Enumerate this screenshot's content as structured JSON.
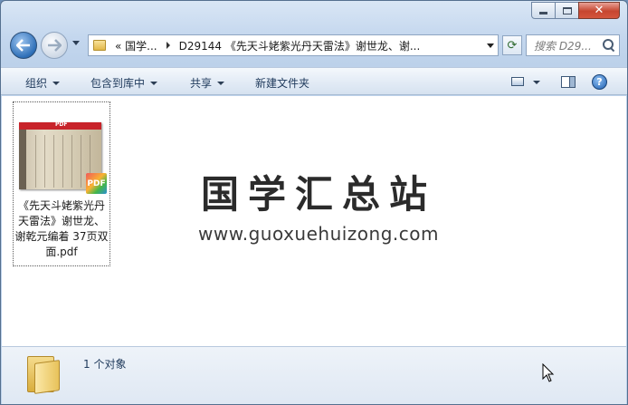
{
  "window": {
    "title": ""
  },
  "nav": {
    "address_segments": [
      "« 国学...",
      "D29144 《先天斗姥紫光丹天雷法》谢世龙、谢..."
    ],
    "search_placeholder": "搜索 D29..."
  },
  "toolbar": {
    "organize": "组织",
    "include_library": "包含到库中",
    "share": "共享",
    "new_folder": "新建文件夹"
  },
  "files": [
    {
      "name": "《先天斗姥紫光丹天雷法》谢世龙、谢乾元编着 37页双面.pdf",
      "thumb_label": "PDF",
      "badge": "PDF"
    }
  ],
  "watermark": {
    "title": "国学汇总站",
    "url": "www.guoxuehuizong.com"
  },
  "details": {
    "count_text": "1 个对象"
  },
  "colors": {
    "accent": "#1e395b",
    "pdf_red": "#c8232a"
  }
}
